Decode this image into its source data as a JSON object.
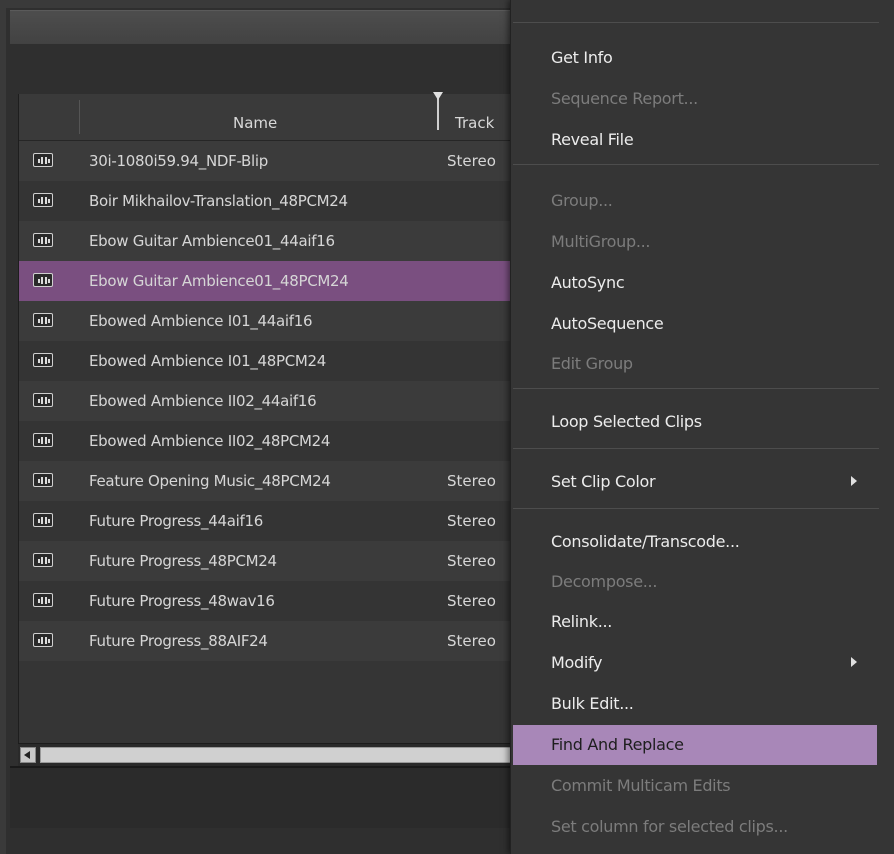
{
  "bin": {
    "columns": {
      "name": "Name",
      "tracks": "Track"
    },
    "rows": [
      {
        "name": "30i-1080i59.94_NDF-Blip",
        "tracks": "Stereo",
        "selected": false
      },
      {
        "name": "Boir Mikhailov-Translation_48PCM24",
        "tracks": "",
        "selected": false
      },
      {
        "name": "Ebow Guitar Ambience01_44aif16",
        "tracks": "",
        "selected": false
      },
      {
        "name": "Ebow Guitar Ambience01_48PCM24",
        "tracks": "",
        "selected": true
      },
      {
        "name": "Ebowed Ambience I01_44aif16",
        "tracks": "",
        "selected": false
      },
      {
        "name": "Ebowed Ambience I01_48PCM24",
        "tracks": "",
        "selected": false
      },
      {
        "name": "Ebowed Ambience II02_44aif16",
        "tracks": "",
        "selected": false
      },
      {
        "name": "Ebowed Ambience II02_48PCM24",
        "tracks": "",
        "selected": false
      },
      {
        "name": "Feature Opening Music_48PCM24",
        "tracks": "Stereo",
        "selected": false
      },
      {
        "name": "Future Progress_44aif16",
        "tracks": "Stereo",
        "selected": false
      },
      {
        "name": "Future Progress_48PCM24",
        "tracks": "Stereo",
        "selected": false
      },
      {
        "name": "Future Progress_48wav16",
        "tracks": "Stereo",
        "selected": false
      },
      {
        "name": "Future Progress_88AIF24",
        "tracks": "Stereo",
        "selected": false
      }
    ]
  },
  "context_menu": {
    "items": [
      {
        "label": "Get Info",
        "enabled": true
      },
      {
        "label": "Sequence Report...",
        "enabled": false
      },
      {
        "label": "Reveal File",
        "enabled": true
      },
      {
        "label": "Group...",
        "enabled": false
      },
      {
        "label": "MultiGroup...",
        "enabled": false
      },
      {
        "label": "AutoSync",
        "enabled": true
      },
      {
        "label": "AutoSequence",
        "enabled": true
      },
      {
        "label": "Edit Group",
        "enabled": false
      },
      {
        "label": "Loop Selected Clips",
        "enabled": true
      },
      {
        "label": "Set Clip Color",
        "enabled": true,
        "submenu": true
      },
      {
        "label": "Consolidate/Transcode...",
        "enabled": true
      },
      {
        "label": "Decompose...",
        "enabled": false
      },
      {
        "label": "Relink...",
        "enabled": true
      },
      {
        "label": "Modify",
        "enabled": true,
        "submenu": true
      },
      {
        "label": "Bulk Edit...",
        "enabled": true
      },
      {
        "label": "Find And Replace",
        "enabled": true,
        "highlighted": true
      },
      {
        "label": "Commit Multicam Edits",
        "enabled": false
      },
      {
        "label": "Set column for selected clips...",
        "enabled": false
      }
    ]
  },
  "colors": {
    "selection": "#7a4f80",
    "menu_highlight": "#a887b8"
  },
  "icons": {
    "clip": "audio-clip-icon",
    "submenu": "submenu-arrow-icon",
    "scroll_left": "scroll-left-arrow-icon"
  }
}
